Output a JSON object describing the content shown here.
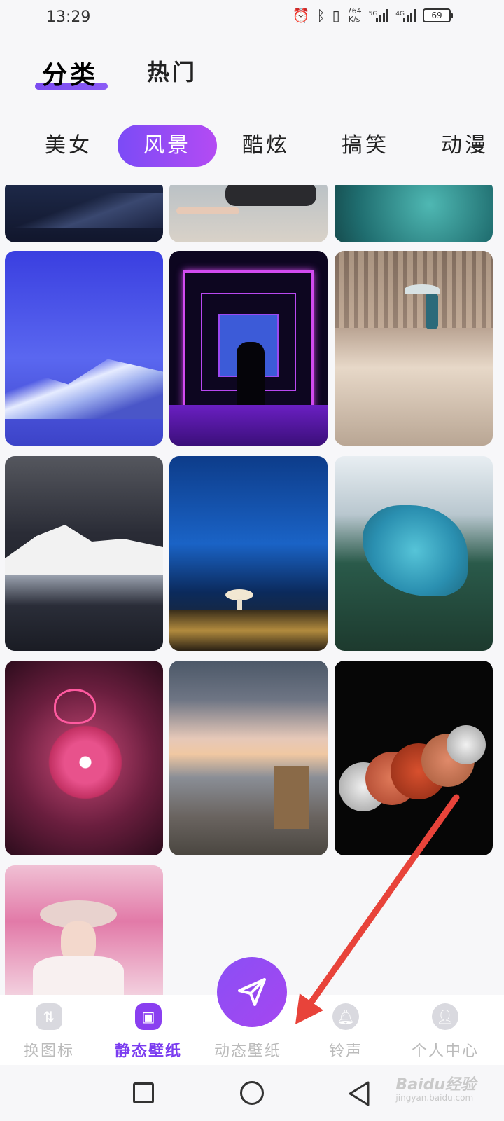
{
  "status_bar": {
    "time": "13:29",
    "net_speed_value": "764",
    "net_speed_unit": "K/s",
    "signal_1_label": "5G",
    "signal_2_label": "4G",
    "battery": "69",
    "icons": [
      "alarm-icon",
      "bluetooth-icon",
      "vibrate-icon"
    ]
  },
  "top_tabs": {
    "active": "分类",
    "inactive": "热门"
  },
  "categories": {
    "items": [
      "美女",
      "风景",
      "酷炫",
      "搞笑",
      "动漫"
    ],
    "selected": "风景"
  },
  "wallpapers": {
    "count_visible": 13
  },
  "bottom_nav": {
    "items": [
      {
        "label": "换图标",
        "icon": "swap-icon-icon"
      },
      {
        "label": "静态壁纸",
        "icon": "image-icon"
      },
      {
        "label": "动态壁纸",
        "icon": "send-icon"
      },
      {
        "label": "铃声",
        "icon": "bell-icon"
      },
      {
        "label": "个人中心",
        "icon": "user-icon"
      }
    ],
    "active": "静态壁纸"
  },
  "watermark": {
    "brand": "Baidu经验",
    "url": "jingyan.baidu.com"
  },
  "colors": {
    "accent": "#8a3ff0",
    "annotation_arrow": "#e8433a"
  }
}
